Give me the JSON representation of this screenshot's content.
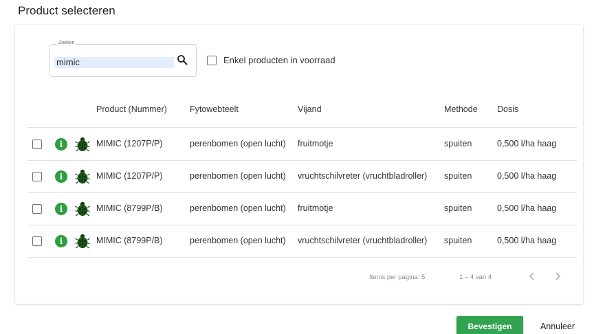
{
  "dialog": {
    "title": "Product selecteren"
  },
  "search": {
    "legend": "Zoeken",
    "value": "mimic",
    "icon": "search-icon"
  },
  "stock_filter": {
    "label": "Enkel producten in voorraad",
    "checked": false
  },
  "table": {
    "columns": [
      "Product (Nummer)",
      "Fytowebteelt",
      "Vijand",
      "Methode",
      "Dosis"
    ],
    "rows": [
      {
        "product": "MIMIC (1207P/P)",
        "crop": "perenbomen (open lucht)",
        "pest": "fruitmotje",
        "method": "spuiten",
        "dose": "0,500 l/ha haag"
      },
      {
        "product": "MIMIC (1207P/P)",
        "crop": "perenbomen (open lucht)",
        "pest": "vruchtschilvreter (vruchtbladroller)",
        "method": "spuiten",
        "dose": "0,500 l/ha haag"
      },
      {
        "product": "MIMIC (8799P/B)",
        "crop": "perenbomen (open lucht)",
        "pest": "fruitmotje",
        "method": "spuiten",
        "dose": "0,500 l/ha haag"
      },
      {
        "product": "MIMIC (8799P/B)",
        "crop": "perenbomen (open lucht)",
        "pest": "vruchtschilvreter (vruchtbladroller)",
        "method": "spuiten",
        "dose": "0,500 l/ha haag"
      }
    ]
  },
  "pagination": {
    "items_per_page_label": "Items per pagina:",
    "items_per_page": "5",
    "range": "1 – 4 van 4"
  },
  "actions": {
    "confirm": "Bevestigen",
    "cancel": "Annuleer"
  },
  "colors": {
    "accent_green": "#32a350",
    "info_green": "#2e9e3f",
    "bug_green": "#1d5a1d",
    "search_highlight": "#e3edfb"
  }
}
